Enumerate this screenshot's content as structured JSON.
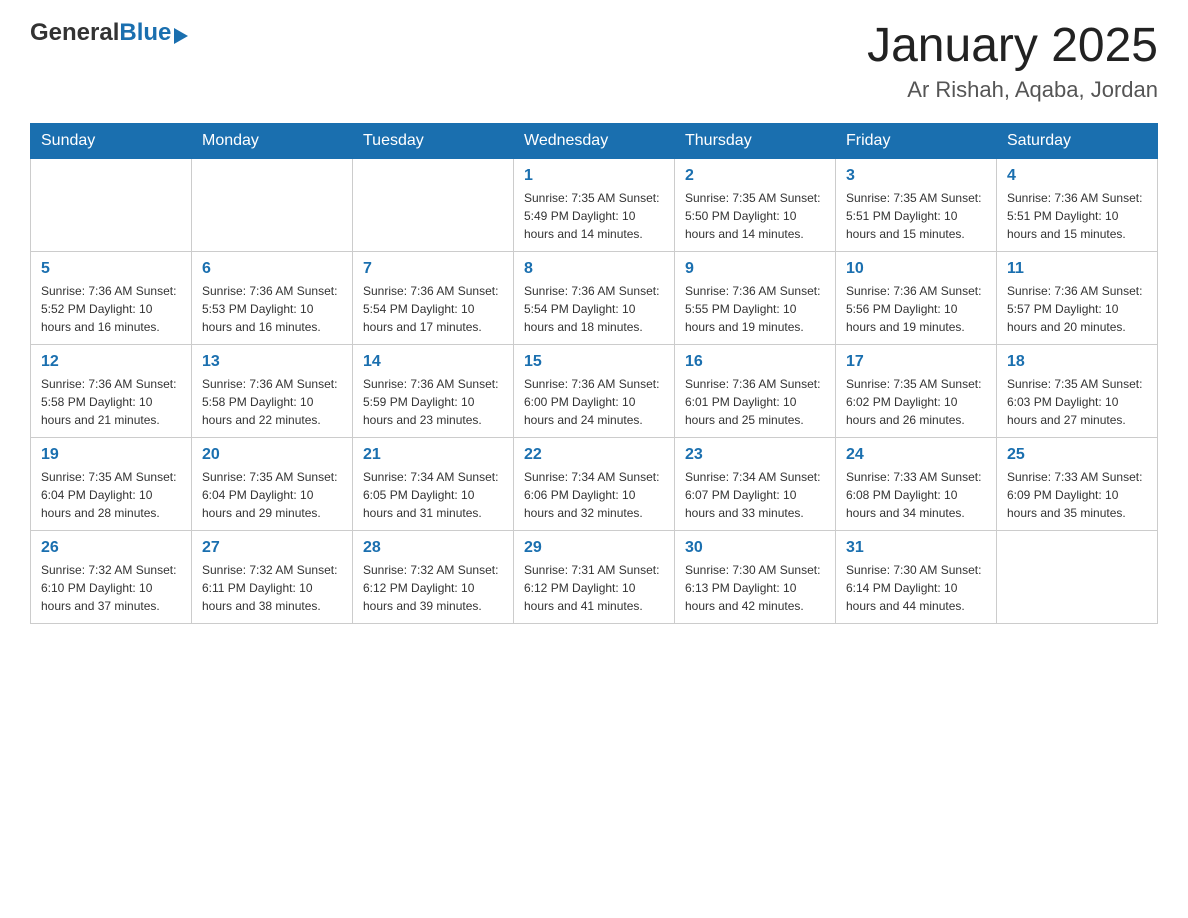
{
  "header": {
    "logo": {
      "general": "General",
      "blue": "Blue",
      "arrow_desc": "blue right-pointing triangle"
    },
    "title": "January 2025",
    "subtitle": "Ar Rishah, Aqaba, Jordan"
  },
  "weekdays": [
    "Sunday",
    "Monday",
    "Tuesday",
    "Wednesday",
    "Thursday",
    "Friday",
    "Saturday"
  ],
  "weeks": [
    [
      {
        "day": "",
        "info": ""
      },
      {
        "day": "",
        "info": ""
      },
      {
        "day": "",
        "info": ""
      },
      {
        "day": "1",
        "info": "Sunrise: 7:35 AM\nSunset: 5:49 PM\nDaylight: 10 hours\nand 14 minutes."
      },
      {
        "day": "2",
        "info": "Sunrise: 7:35 AM\nSunset: 5:50 PM\nDaylight: 10 hours\nand 14 minutes."
      },
      {
        "day": "3",
        "info": "Sunrise: 7:35 AM\nSunset: 5:51 PM\nDaylight: 10 hours\nand 15 minutes."
      },
      {
        "day": "4",
        "info": "Sunrise: 7:36 AM\nSunset: 5:51 PM\nDaylight: 10 hours\nand 15 minutes."
      }
    ],
    [
      {
        "day": "5",
        "info": "Sunrise: 7:36 AM\nSunset: 5:52 PM\nDaylight: 10 hours\nand 16 minutes."
      },
      {
        "day": "6",
        "info": "Sunrise: 7:36 AM\nSunset: 5:53 PM\nDaylight: 10 hours\nand 16 minutes."
      },
      {
        "day": "7",
        "info": "Sunrise: 7:36 AM\nSunset: 5:54 PM\nDaylight: 10 hours\nand 17 minutes."
      },
      {
        "day": "8",
        "info": "Sunrise: 7:36 AM\nSunset: 5:54 PM\nDaylight: 10 hours\nand 18 minutes."
      },
      {
        "day": "9",
        "info": "Sunrise: 7:36 AM\nSunset: 5:55 PM\nDaylight: 10 hours\nand 19 minutes."
      },
      {
        "day": "10",
        "info": "Sunrise: 7:36 AM\nSunset: 5:56 PM\nDaylight: 10 hours\nand 19 minutes."
      },
      {
        "day": "11",
        "info": "Sunrise: 7:36 AM\nSunset: 5:57 PM\nDaylight: 10 hours\nand 20 minutes."
      }
    ],
    [
      {
        "day": "12",
        "info": "Sunrise: 7:36 AM\nSunset: 5:58 PM\nDaylight: 10 hours\nand 21 minutes."
      },
      {
        "day": "13",
        "info": "Sunrise: 7:36 AM\nSunset: 5:58 PM\nDaylight: 10 hours\nand 22 minutes."
      },
      {
        "day": "14",
        "info": "Sunrise: 7:36 AM\nSunset: 5:59 PM\nDaylight: 10 hours\nand 23 minutes."
      },
      {
        "day": "15",
        "info": "Sunrise: 7:36 AM\nSunset: 6:00 PM\nDaylight: 10 hours\nand 24 minutes."
      },
      {
        "day": "16",
        "info": "Sunrise: 7:36 AM\nSunset: 6:01 PM\nDaylight: 10 hours\nand 25 minutes."
      },
      {
        "day": "17",
        "info": "Sunrise: 7:35 AM\nSunset: 6:02 PM\nDaylight: 10 hours\nand 26 minutes."
      },
      {
        "day": "18",
        "info": "Sunrise: 7:35 AM\nSunset: 6:03 PM\nDaylight: 10 hours\nand 27 minutes."
      }
    ],
    [
      {
        "day": "19",
        "info": "Sunrise: 7:35 AM\nSunset: 6:04 PM\nDaylight: 10 hours\nand 28 minutes."
      },
      {
        "day": "20",
        "info": "Sunrise: 7:35 AM\nSunset: 6:04 PM\nDaylight: 10 hours\nand 29 minutes."
      },
      {
        "day": "21",
        "info": "Sunrise: 7:34 AM\nSunset: 6:05 PM\nDaylight: 10 hours\nand 31 minutes."
      },
      {
        "day": "22",
        "info": "Sunrise: 7:34 AM\nSunset: 6:06 PM\nDaylight: 10 hours\nand 32 minutes."
      },
      {
        "day": "23",
        "info": "Sunrise: 7:34 AM\nSunset: 6:07 PM\nDaylight: 10 hours\nand 33 minutes."
      },
      {
        "day": "24",
        "info": "Sunrise: 7:33 AM\nSunset: 6:08 PM\nDaylight: 10 hours\nand 34 minutes."
      },
      {
        "day": "25",
        "info": "Sunrise: 7:33 AM\nSunset: 6:09 PM\nDaylight: 10 hours\nand 35 minutes."
      }
    ],
    [
      {
        "day": "26",
        "info": "Sunrise: 7:32 AM\nSunset: 6:10 PM\nDaylight: 10 hours\nand 37 minutes."
      },
      {
        "day": "27",
        "info": "Sunrise: 7:32 AM\nSunset: 6:11 PM\nDaylight: 10 hours\nand 38 minutes."
      },
      {
        "day": "28",
        "info": "Sunrise: 7:32 AM\nSunset: 6:12 PM\nDaylight: 10 hours\nand 39 minutes."
      },
      {
        "day": "29",
        "info": "Sunrise: 7:31 AM\nSunset: 6:12 PM\nDaylight: 10 hours\nand 41 minutes."
      },
      {
        "day": "30",
        "info": "Sunrise: 7:30 AM\nSunset: 6:13 PM\nDaylight: 10 hours\nand 42 minutes."
      },
      {
        "day": "31",
        "info": "Sunrise: 7:30 AM\nSunset: 6:14 PM\nDaylight: 10 hours\nand 44 minutes."
      },
      {
        "day": "",
        "info": ""
      }
    ]
  ]
}
